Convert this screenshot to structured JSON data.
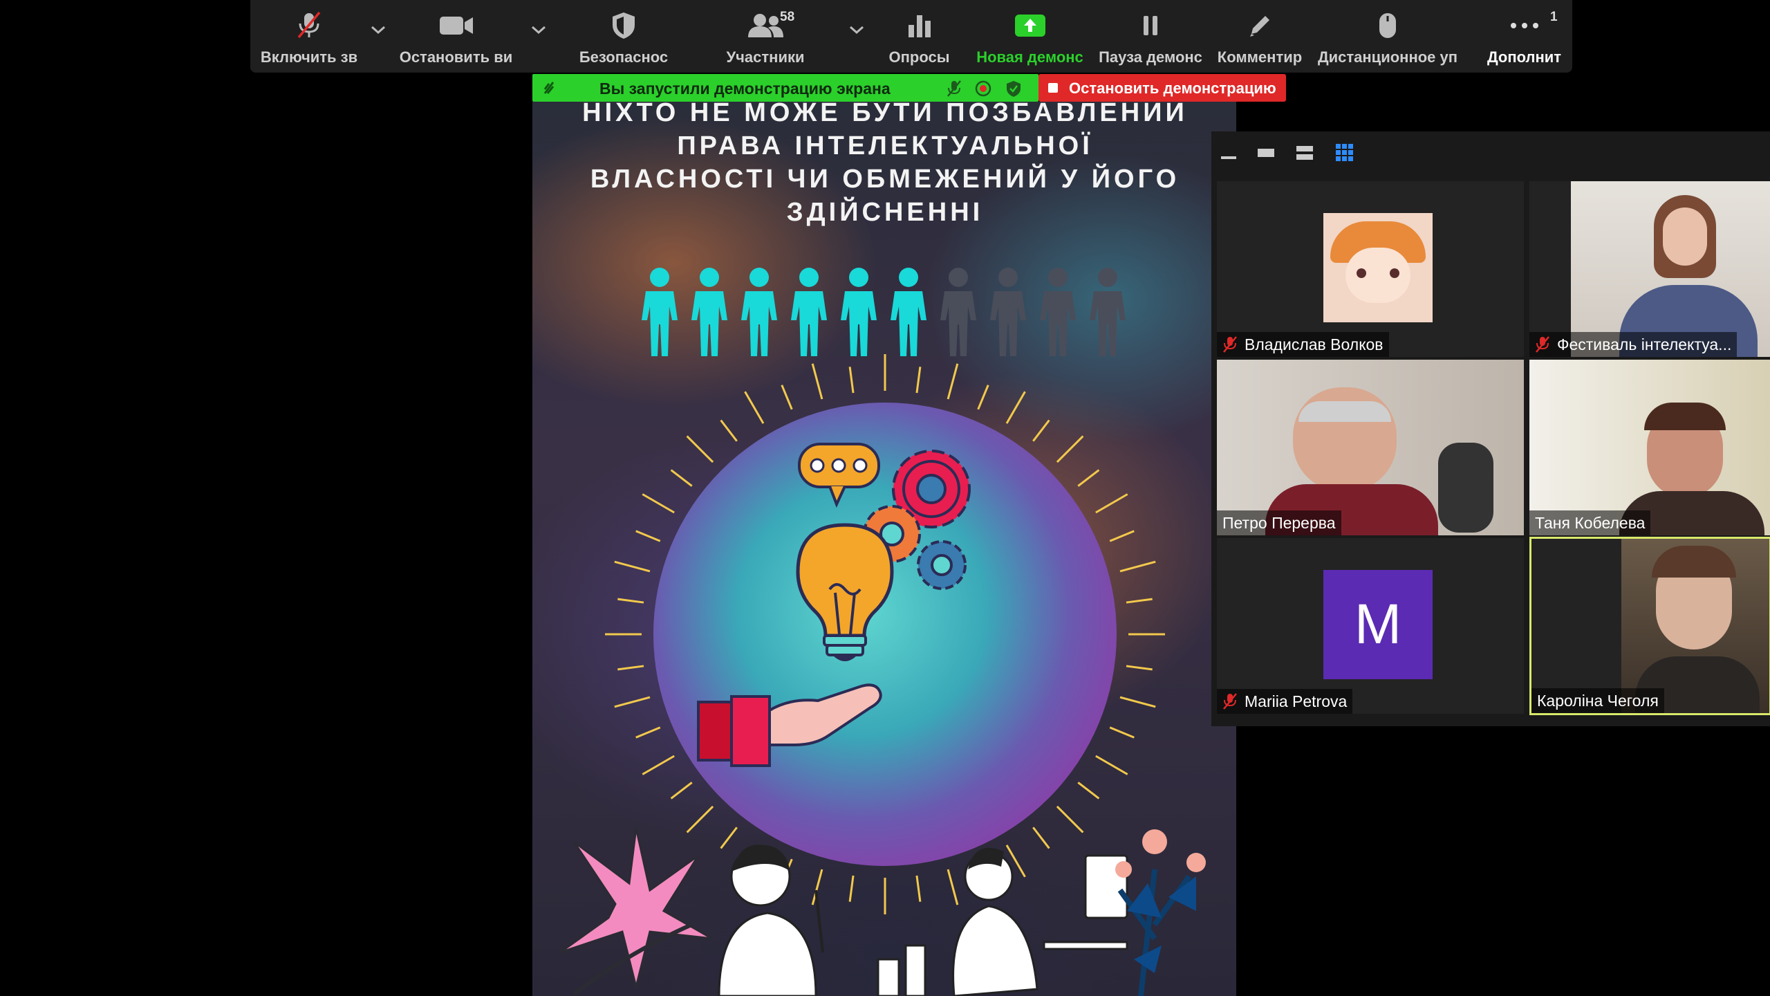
{
  "toolbar": {
    "mute": {
      "label": "Включить зв"
    },
    "video": {
      "label": "Остановить ви"
    },
    "security": {
      "label": "Безопаснос"
    },
    "participants": {
      "label": "Участники",
      "count": "58"
    },
    "polls": {
      "label": "Опросы"
    },
    "new_share": {
      "label": "Новая демонс"
    },
    "pause_share": {
      "label": "Пауза демонс"
    },
    "annotate": {
      "label": "Комментир"
    },
    "remote_control": {
      "label": "Дистанционное уп"
    },
    "more": {
      "label": "Дополнит",
      "count": "1"
    }
  },
  "share_banner": {
    "text": "Вы запустили демонстрацию экрана",
    "stop_label": "Остановить демонстрацию"
  },
  "slide": {
    "title_lines": [
      "НІХТО НЕ МОЖЕ БУТИ ПОЗБАВЛЕНИЙ",
      "ПРАВА ІНТЕЛЕКТУАЛЬНОЇ",
      "ВЛАСНОСТІ ЧИ ОБМЕЖЕНИЙ У ЙОГО",
      "ЗДІЙСНЕННІ"
    ],
    "people_highlighted": 6,
    "people_total": 10,
    "accent_color": "#19d9d9"
  },
  "gallery": {
    "participants": [
      {
        "name": "Владислав Волков",
        "muted": true,
        "video": "avatar-image"
      },
      {
        "name": "Фестиваль інтелектуа...",
        "muted": true,
        "video": "camera"
      },
      {
        "name": "Петро Перерва",
        "muted": false,
        "video": "camera"
      },
      {
        "name": "Таня Кобелева",
        "muted": false,
        "video": "camera"
      },
      {
        "name": "Mariia Petrova",
        "muted": true,
        "video": "off",
        "initial": "M"
      },
      {
        "name": "Кароліна Чеголя",
        "muted": false,
        "video": "camera",
        "active_speaker": true
      }
    ]
  },
  "colors": {
    "toolbar_bg": "#1f1f1f",
    "share_green": "#2bd02b",
    "stop_red": "#e02828",
    "active_speaker_border": "#d8e86a",
    "avatar_purple": "#5b2bb3"
  }
}
